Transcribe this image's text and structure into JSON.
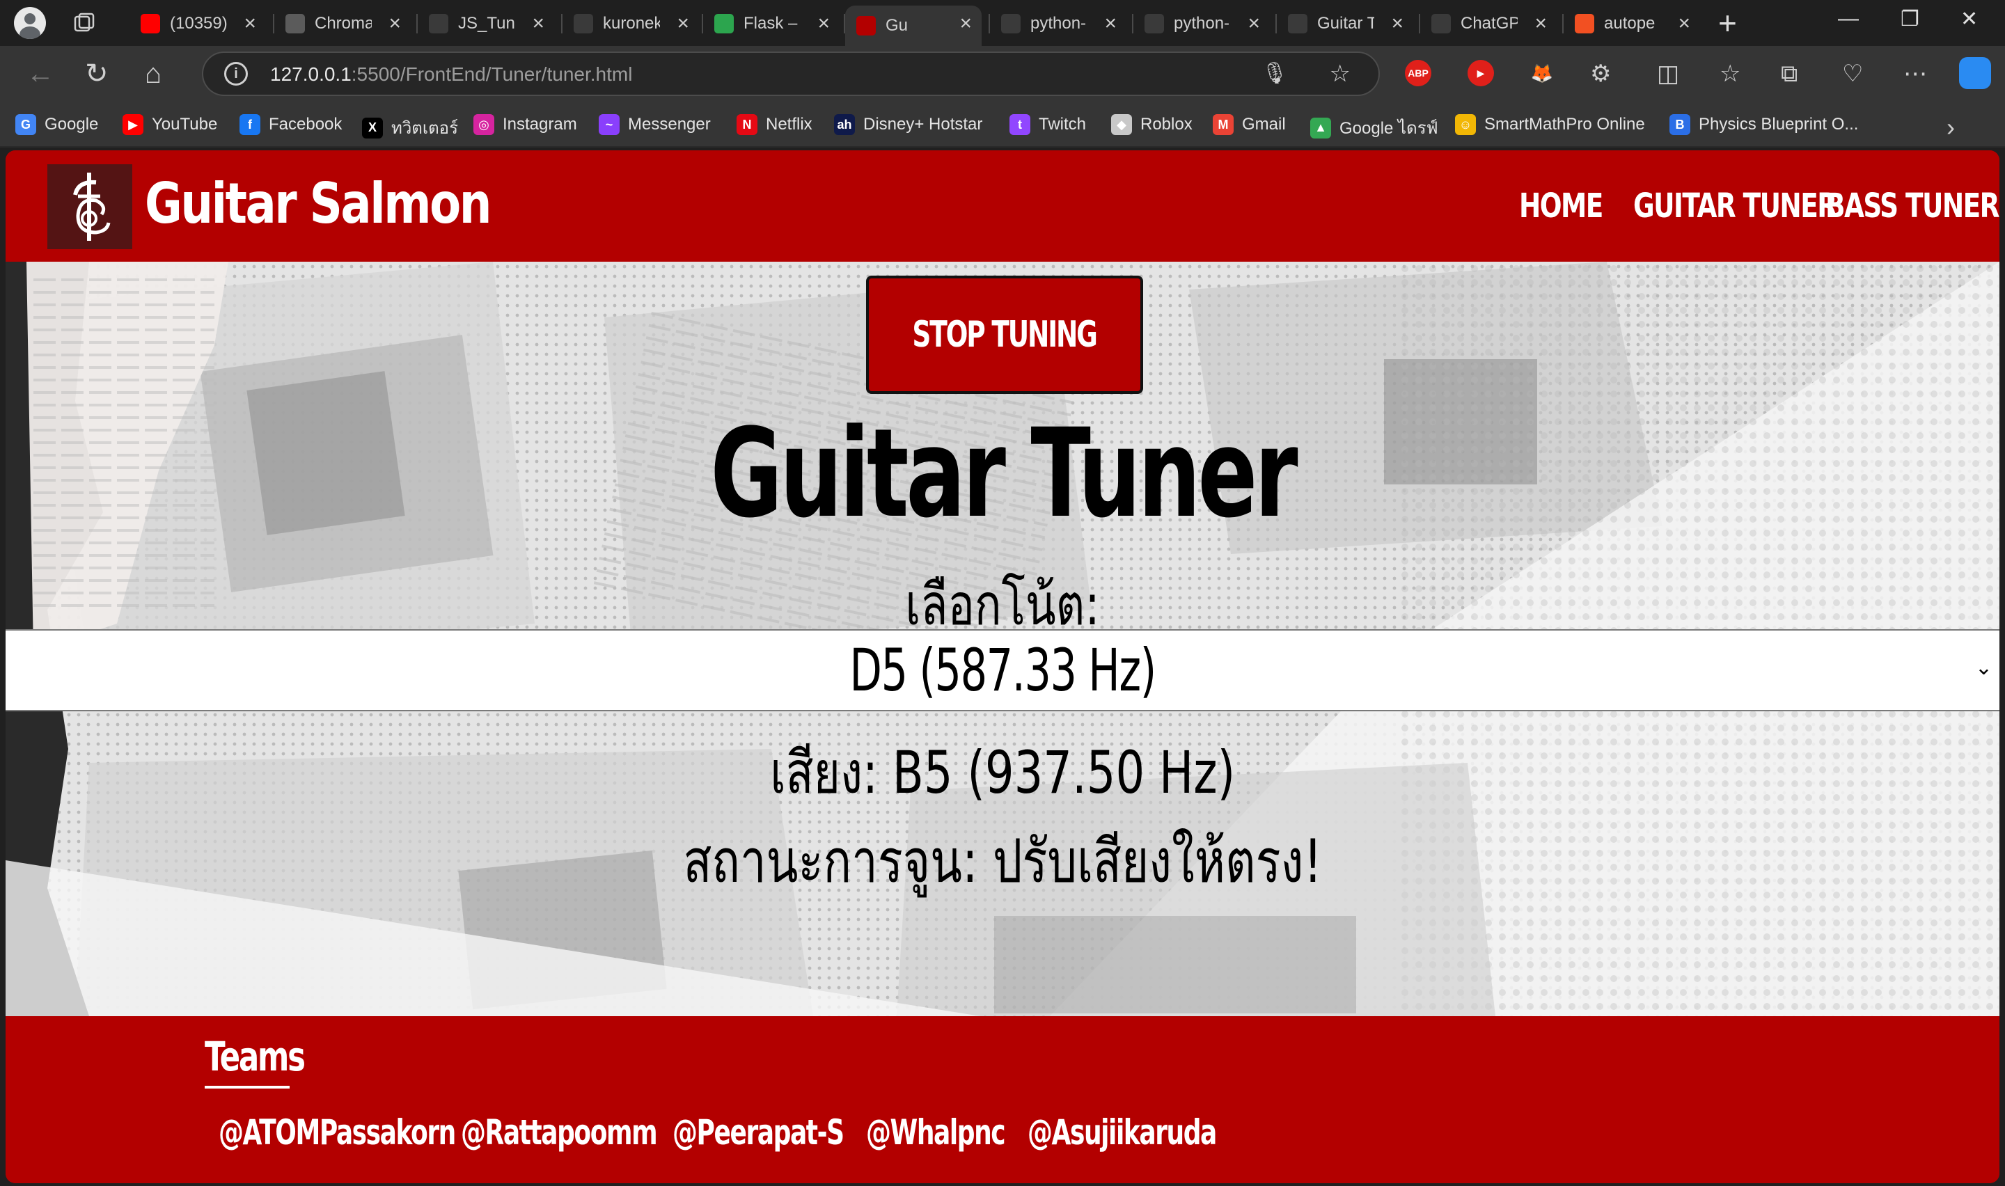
{
  "browser": {
    "tabs": [
      {
        "title": "(10359)",
        "icon": "youtube-icon",
        "color": "#ff0000"
      },
      {
        "title": "Chroma",
        "icon": "chroma-icon",
        "color": "#5b5b5b"
      },
      {
        "title": "JS_Tuner",
        "icon": "github-icon",
        "color": "#3a3a3a"
      },
      {
        "title": "kuronek",
        "icon": "github-icon",
        "color": "#3a3a3a"
      },
      {
        "title": "Flask – I",
        "icon": "flask-icon",
        "color": "#2ca54e"
      },
      {
        "title": "Gu",
        "icon": "guitar-salmon-icon",
        "color": "#b30000",
        "active": true
      },
      {
        "title": "python-",
        "icon": "github-icon",
        "color": "#3a3a3a"
      },
      {
        "title": "python-",
        "icon": "github-icon",
        "color": "#3a3a3a"
      },
      {
        "title": "Guitar T",
        "icon": "file-icon",
        "color": "#3a3a3a"
      },
      {
        "title": "ChatGP",
        "icon": "chatgpt-icon",
        "color": "#3a3a3a"
      },
      {
        "title": "autope",
        "icon": "microsoft-icon",
        "color": "#f25022"
      }
    ],
    "url_host": "127.0.0.1",
    "url_path": ":5500/FrontEnd/Tuner/tuner.html",
    "bookmarks": [
      {
        "label": "Google",
        "icon": "google-icon",
        "color": "#4285f4",
        "glyph": "G"
      },
      {
        "label": "YouTube",
        "icon": "youtube-icon",
        "color": "#ff0000",
        "glyph": "▶"
      },
      {
        "label": "Facebook",
        "icon": "facebook-icon",
        "color": "#1877f2",
        "glyph": "f"
      },
      {
        "label": "ทวิตเตอร์",
        "icon": "x-icon",
        "color": "#000000",
        "glyph": "X"
      },
      {
        "label": "Instagram",
        "icon": "instagram-icon",
        "color": "#d6249f",
        "glyph": "◎"
      },
      {
        "label": "Messenger",
        "icon": "messenger-icon",
        "color": "#8a3ffc",
        "glyph": "~"
      },
      {
        "label": "Netflix",
        "icon": "netflix-icon",
        "color": "#e50914",
        "glyph": "N"
      },
      {
        "label": "Disney+ Hotstar",
        "icon": "hotstar-icon",
        "color": "#0f1a4a",
        "glyph": "ah"
      },
      {
        "label": "Twitch",
        "icon": "twitch-icon",
        "color": "#9146ff",
        "glyph": "t"
      },
      {
        "label": "Roblox",
        "icon": "roblox-icon",
        "color": "#c8c8c8",
        "glyph": "◆"
      },
      {
        "label": "Gmail",
        "icon": "gmail-icon",
        "color": "#ea4335",
        "glyph": "M"
      },
      {
        "label": "Google ไดรฟ์",
        "icon": "drive-icon",
        "color": "#34a853",
        "glyph": "▲"
      },
      {
        "label": "SmartMathPro Online",
        "icon": "smartmath-icon",
        "color": "#f2b705",
        "glyph": "☺"
      },
      {
        "label": "Physics Blueprint O...",
        "icon": "physics-blueprint-icon",
        "color": "#2b6ee6",
        "glyph": "B"
      }
    ],
    "extensions": [
      {
        "icon": "adblock-icon",
        "label": "ABP",
        "color": "#e0201a"
      },
      {
        "icon": "youtube-ext-icon",
        "label": "▶",
        "color": "#e0201a"
      },
      {
        "icon": "metamask-icon",
        "label": "🦊",
        "color": "#353535"
      }
    ]
  },
  "site": {
    "title": "Guitar Salmon",
    "nav": [
      "HOME",
      "GUITAR TUNER",
      "BASS TUNER"
    ]
  },
  "tuner": {
    "stop_button": "STOP TUNING",
    "heading": "Guitar Tuner",
    "select_label": "เลือกโน้ต:",
    "selected_note": "D5 (587.33 Hz)",
    "detected": "เสียง: B5 (937.50 Hz)",
    "status": "สถานะการจูน: ปรับเสียงให้ตรง!"
  },
  "footer": {
    "teams_title": "Teams",
    "members": [
      "@ATOMPassakorn",
      "@Rattapoomm",
      "@Peerapat-S",
      "@Whalpnc",
      "@Asujiikaruda"
    ]
  },
  "colors": {
    "brand_red": "#b30000",
    "logo_dark": "#541414"
  }
}
